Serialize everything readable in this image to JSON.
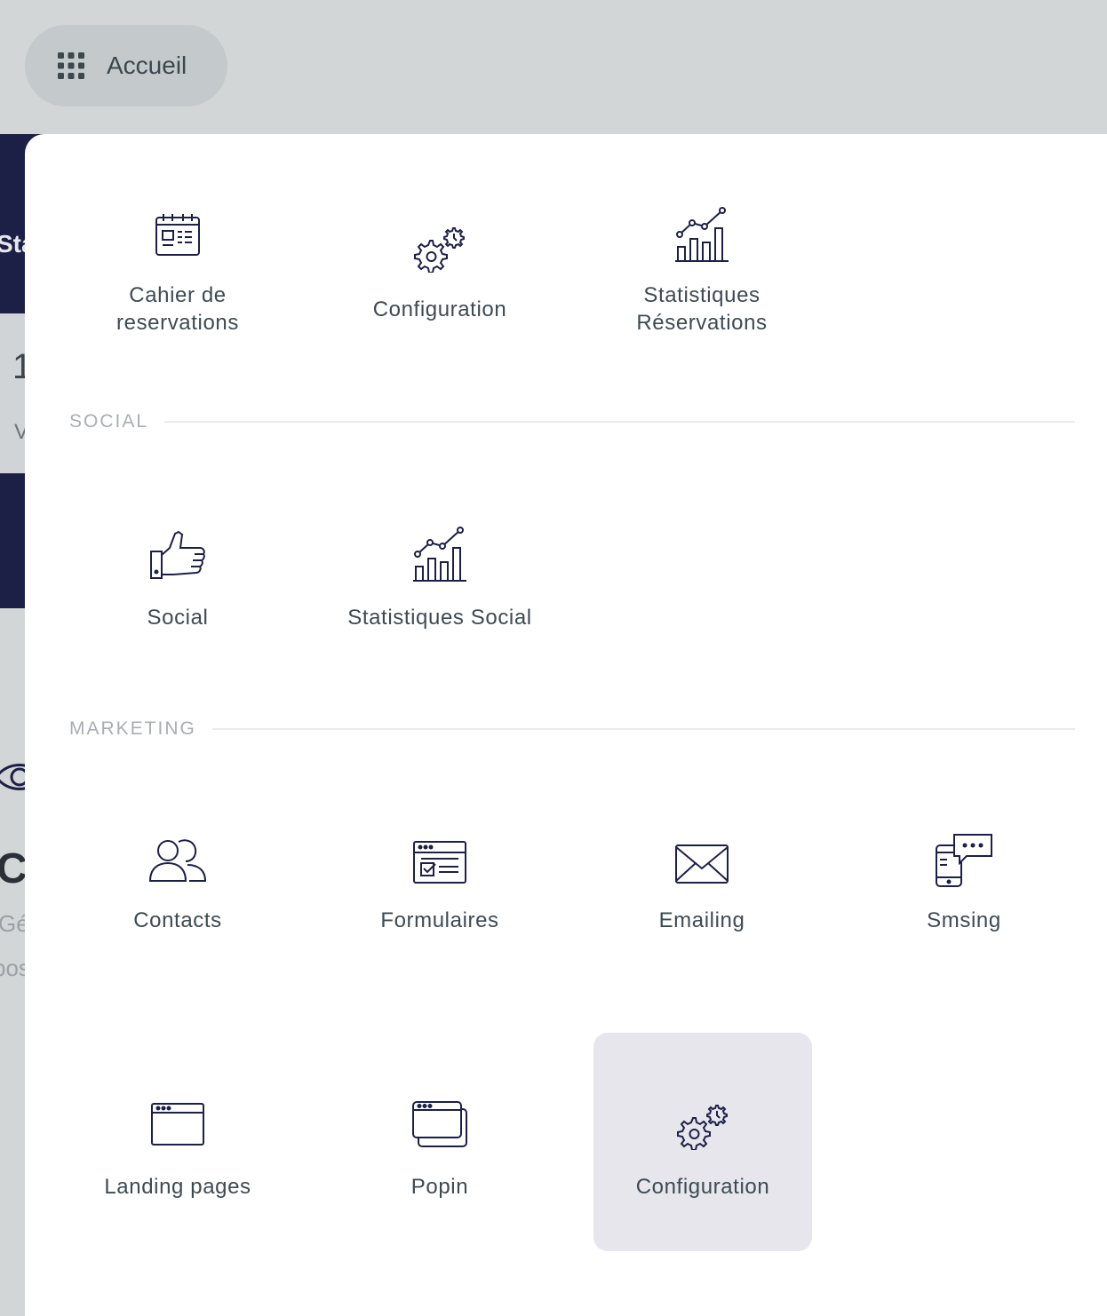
{
  "topbar": {
    "home_label": "Accueil"
  },
  "background": {
    "dark_text": "Sta",
    "card_number": "1",
    "card_sub": "V",
    "big_text": "Co",
    "sub_text_1": "Gé",
    "sub_text_2": "pos"
  },
  "menu": {
    "top_items": [
      {
        "label": "Cahier de reservations",
        "line1": "Cahier de",
        "line2": "reservations"
      },
      {
        "label": "Configuration"
      },
      {
        "label": "Statistiques Réservations",
        "line1": "Statistiques",
        "line2": "Réservations"
      }
    ],
    "sections": [
      {
        "title": "SOCIAL",
        "items": [
          {
            "label": "Social"
          },
          {
            "label": "Statistiques Social"
          }
        ]
      },
      {
        "title": "MARKETING",
        "items": [
          {
            "label": "Contacts"
          },
          {
            "label": "Formulaires"
          },
          {
            "label": "Emailing"
          },
          {
            "label": "Smsing"
          },
          {
            "label": "Landing pages"
          },
          {
            "label": "Popin"
          },
          {
            "label": "Configuration",
            "active": true
          }
        ]
      }
    ]
  },
  "colors": {
    "icon_stroke": "#1d2046",
    "active_tile": "#e6e6ec",
    "panel": "#ffffff",
    "dark_bg": "#1d2046"
  }
}
